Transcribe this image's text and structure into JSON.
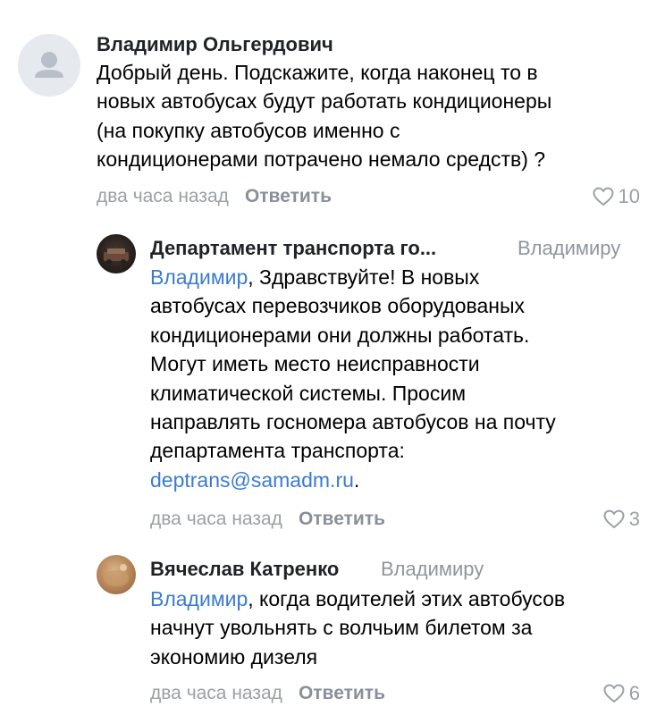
{
  "comments": [
    {
      "author": "Владимир Ольгердович",
      "reply_to": "",
      "text": "Добрый день. Подскажите, когда наконец то в\nновых автобусах будут работать кондиционеры\n(на покупку автобусов именно с\nкондиционерами потрачено немало средств) ?",
      "time": "два часа назад",
      "reply_label": "Ответить",
      "likes": "10",
      "like_icon": "heart-outline-icon"
    },
    {
      "author": "Департамент транспорта го...",
      "reply_to": "Владимиру",
      "mention": "Владимир",
      "text": ", Здравствуйте! В новых\nавтобусах перевозчиков оборудованых\nкондиционерами они должны работать.\nМогут иметь место неисправности\nклиматической системы. Просим\nнаправлять госномера автобусов на почту\nдепартамента транспорта:\n",
      "link": "deptrans@samadm.ru",
      "text_tail": ".",
      "time": "два часа назад",
      "reply_label": "Ответить",
      "likes": "3",
      "like_icon": "heart-outline-icon"
    },
    {
      "author": "Вячеслав Катренко",
      "reply_to": "Владимиру",
      "mention": "Владимир",
      "text": ", когда водителей этих автобусов\nначнут увольнять с волчьим билетом за\nэкономию дизеля",
      "time": "два часа назад",
      "reply_label": "Ответить",
      "likes": "6",
      "like_icon": "heart-outline-icon"
    }
  ],
  "colors": {
    "link": "#3a7bd0",
    "muted": "#9aa0a6",
    "avatar_placeholder": "#e6e9ee"
  }
}
